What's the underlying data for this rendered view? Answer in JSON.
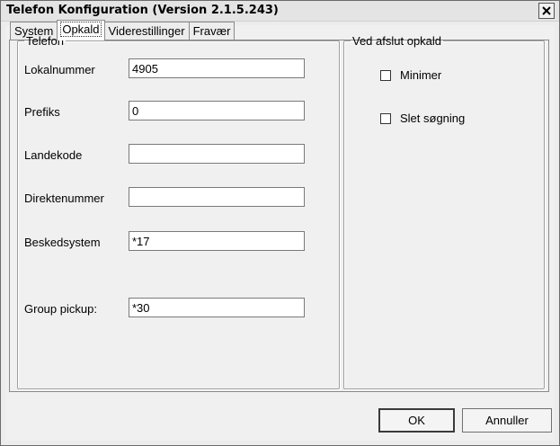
{
  "window": {
    "title": "Telefon Konfiguration (Version 2.1.5.243)"
  },
  "tabs": [
    {
      "label": "System"
    },
    {
      "label": "Opkald"
    },
    {
      "label": "Viderestillinger"
    },
    {
      "label": "Fravær"
    }
  ],
  "telefon": {
    "legend": "Telefon",
    "fields": [
      {
        "label": "Lokalnummer",
        "value": "4905"
      },
      {
        "label": "Prefiks",
        "value": "0"
      },
      {
        "label": "Landekode",
        "value": ""
      },
      {
        "label": "Direktenummer",
        "value": ""
      },
      {
        "label": "Beskedsystem",
        "value": "*17"
      },
      {
        "label": "Group pickup:",
        "value": "*30"
      }
    ]
  },
  "afslut": {
    "legend": "Ved afslut opkald",
    "options": [
      {
        "label": "Minimer",
        "checked": false
      },
      {
        "label": "Slet søgning",
        "checked": false
      }
    ]
  },
  "buttons": {
    "ok": "OK",
    "cancel": "Annuller"
  },
  "icons": {
    "close": "close-icon"
  }
}
